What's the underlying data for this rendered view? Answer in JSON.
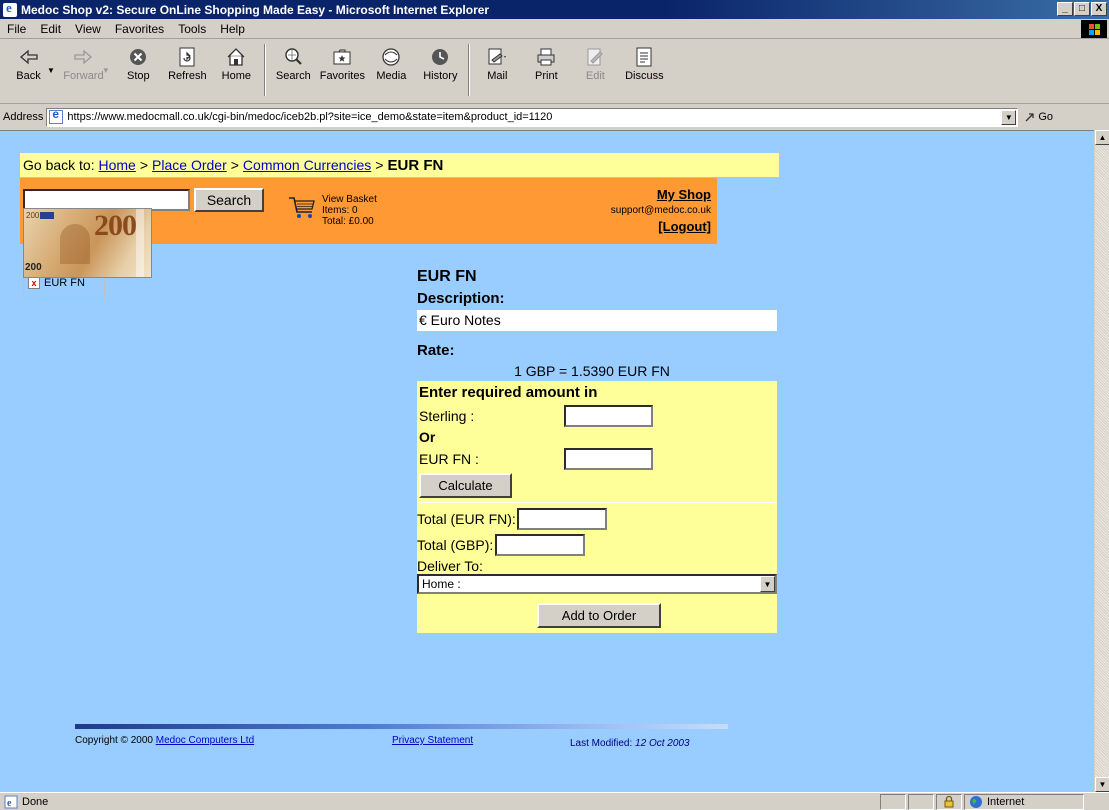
{
  "window": {
    "title": "Medoc Shop v2: Secure OnLine Shopping Made Easy - Microsoft Internet Explorer",
    "controls": [
      "_",
      "□",
      "X"
    ]
  },
  "menu": [
    "File",
    "Edit",
    "View",
    "Favorites",
    "Tools",
    "Help"
  ],
  "toolbar": {
    "back": "Back",
    "forward": "Forward",
    "stop": "Stop",
    "refresh": "Refresh",
    "home": "Home",
    "search": "Search",
    "favorites": "Favorites",
    "media": "Media",
    "history": "History",
    "mail": "Mail",
    "print": "Print",
    "edit": "Edit",
    "discuss": "Discuss"
  },
  "address": {
    "label": "Address",
    "url": "https://www.medocmall.co.uk/cgi-bin/medoc/iceb2b.pl?site=ice_demo&state=item&product_id=1120",
    "go": "Go"
  },
  "breadcrumb": {
    "prefix": "Go back to:",
    "links": [
      "Home",
      "Place Order",
      "Common Currencies"
    ],
    "current": "EUR FN",
    "separator": ">"
  },
  "shopbar": {
    "search_value": "",
    "search_button": "Search",
    "basket": {
      "line1": "View Basket",
      "line2": "Items: 0",
      "line3": "Total: £0.00"
    },
    "my_shop": "My Shop",
    "email": "support@medoc.co.uk",
    "logout": "[Logout]"
  },
  "product_image": {
    "note_value": "200",
    "alt": "EUR FN"
  },
  "product": {
    "title": "EUR FN",
    "description_label": "Description:",
    "description": "€ Euro Notes",
    "rate_label": "Rate:",
    "rate": "1 GBP = 1.5390 EUR FN",
    "enter_heading": "Enter required amount in",
    "sterling_label": "Sterling :",
    "or_label": "Or",
    "eur_label": "EUR FN :",
    "sterling_value": "",
    "eur_value": "",
    "calculate": "Calculate",
    "total_eur_label": "Total (EUR FN):",
    "total_gbp_label": "Total (GBP):",
    "total_eur_value": "",
    "total_gbp_value": "",
    "deliver_label": "Deliver To:",
    "deliver_selected": "Home :",
    "add_to_order": "Add to Order"
  },
  "footer": {
    "copyright": "Copyright © 2000",
    "company": "Medoc Computers Ltd",
    "privacy": "Privacy Statement",
    "modified_label": "Last Modified:",
    "modified_date": "12 Oct 2003"
  },
  "status": {
    "text": "Done",
    "zone": "Internet"
  }
}
